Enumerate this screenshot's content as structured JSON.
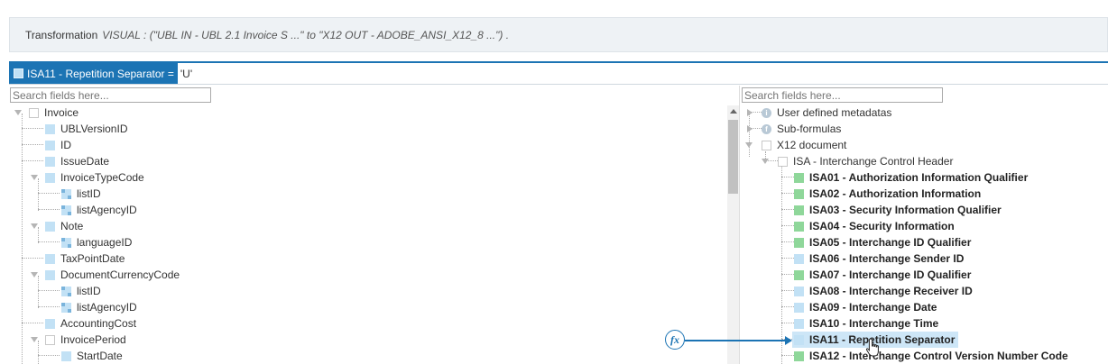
{
  "banner": {
    "label": "Transformation",
    "description": "VISUAL : (\"UBL IN - UBL 2.1 Invoice S ...\" to \"X12 OUT - ADOBE_ANSI_X12_8 ...\") ."
  },
  "formula": {
    "field": "ISA11 - Repetition Separator =",
    "value": "'U'"
  },
  "search": {
    "left_placeholder": "Search fields here...",
    "right_placeholder": "Search fields here..."
  },
  "left_tree": [
    {
      "label": "Invoice"
    },
    {
      "label": "UBLVersionID"
    },
    {
      "label": "ID"
    },
    {
      "label": "IssueDate"
    },
    {
      "label": "InvoiceTypeCode"
    },
    {
      "label": "listID"
    },
    {
      "label": "listAgencyID"
    },
    {
      "label": "Note"
    },
    {
      "label": "languageID"
    },
    {
      "label": "TaxPointDate"
    },
    {
      "label": "DocumentCurrencyCode"
    },
    {
      "label": "listID"
    },
    {
      "label": "listAgencyID"
    },
    {
      "label": "AccountingCost"
    },
    {
      "label": "InvoicePeriod"
    },
    {
      "label": "StartDate"
    }
  ],
  "right_tree": [
    {
      "label": "User defined metadatas"
    },
    {
      "label": "Sub-formulas"
    },
    {
      "label": "X12 document"
    },
    {
      "label": "ISA - Interchange Control Header"
    },
    {
      "label": "ISA01 - Authorization Information Qualifier"
    },
    {
      "label": "ISA02 - Authorization Information"
    },
    {
      "label": "ISA03 - Security Information Qualifier"
    },
    {
      "label": "ISA04 - Security Information"
    },
    {
      "label": "ISA05 - Interchange ID Qualifier"
    },
    {
      "label": "ISA06 - Interchange Sender ID"
    },
    {
      "label": "ISA07 - Interchange ID Qualifier"
    },
    {
      "label": "ISA08 - Interchange Receiver ID"
    },
    {
      "label": "ISA09 - Interchange Date"
    },
    {
      "label": "ISA10 - Interchange Time"
    },
    {
      "label": "ISA11 - Repetition Separator"
    },
    {
      "label": "ISA12 - Interchange Control Version Number Code"
    }
  ],
  "icons": {
    "formula": "fx",
    "info": "i",
    "sub": "f"
  },
  "colors": {
    "accent": "#1c74b4",
    "mapped_field": "#8fd79a",
    "field": "#c2e1f5"
  }
}
